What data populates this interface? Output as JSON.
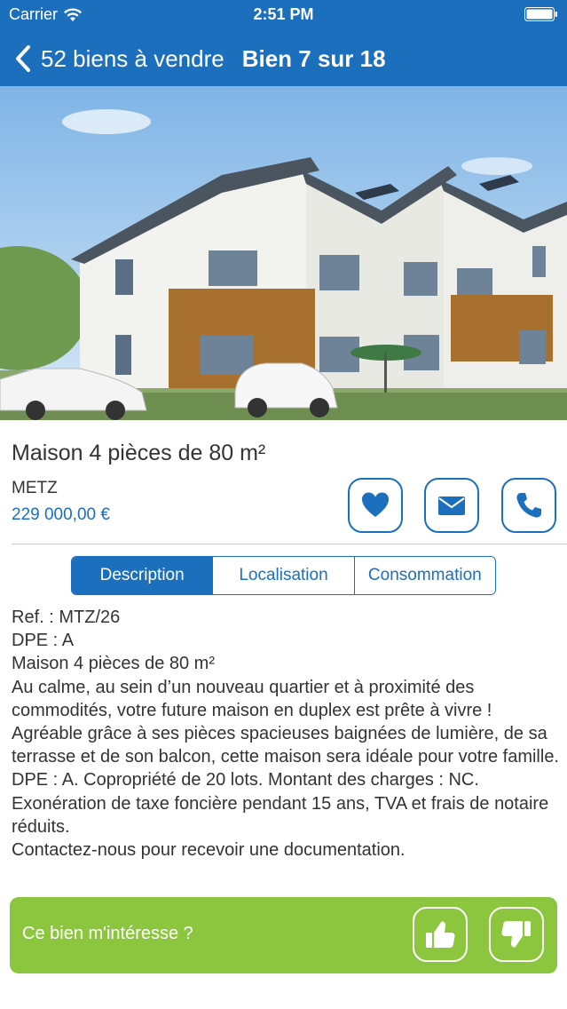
{
  "status": {
    "carrier": "Carrier",
    "time": "2:51 PM"
  },
  "nav": {
    "back_label": "52 biens à vendre",
    "title": "Bien 7 sur 18"
  },
  "listing": {
    "title": "Maison 4 pièces de 80 m²",
    "city": "METZ",
    "price": "229 000,00 €"
  },
  "actions": [
    "heart-icon",
    "mail-icon",
    "phone-icon"
  ],
  "tabs": [
    {
      "label": "Description",
      "active": true
    },
    {
      "label": "Localisation",
      "active": false
    },
    {
      "label": "Consommation",
      "active": false
    }
  ],
  "description": {
    "lines": [
      "Ref. : MTZ/26",
      "DPE : A",
      "Maison 4 pièces de 80 m²",
      "Au calme, au sein d’un nouveau quartier et à proximité des commodités, votre future maison en duplex est prête à vivre ! Agréable grâce à ses pièces spacieuses baignées de lumière, de sa terrasse et de son balcon, cette maison sera idéale pour votre famille.",
      "DPE : A. Copropriété de 20 lots. Montant des charges : NC.",
      "Exonération de taxe foncière pendant 15 ans, TVA et frais de notaire réduits.",
      "Contactez-nous pour recevoir une documentation."
    ]
  },
  "interest": {
    "label": "Ce bien m'intéresse ?"
  },
  "colors": {
    "primary": "#1b6fbd",
    "accent_green": "#8cc63f"
  }
}
